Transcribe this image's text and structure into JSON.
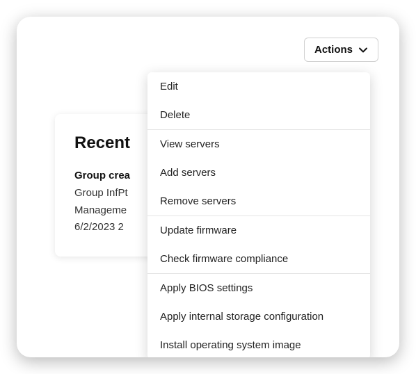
{
  "actions_button": {
    "label": "Actions"
  },
  "recent": {
    "title": "Recent",
    "subtitle": "Group crea",
    "line1": "Group InfPt",
    "line2": "Manageme",
    "line3": "6/2/2023 2"
  },
  "dropdown": {
    "groups": [
      [
        "Edit",
        "Delete"
      ],
      [
        "View servers",
        "Add servers",
        "Remove servers"
      ],
      [
        "Update firmware",
        "Check firmware compliance"
      ],
      [
        "Apply BIOS settings",
        "Apply internal storage configuration",
        "Install operating system image"
      ]
    ]
  }
}
